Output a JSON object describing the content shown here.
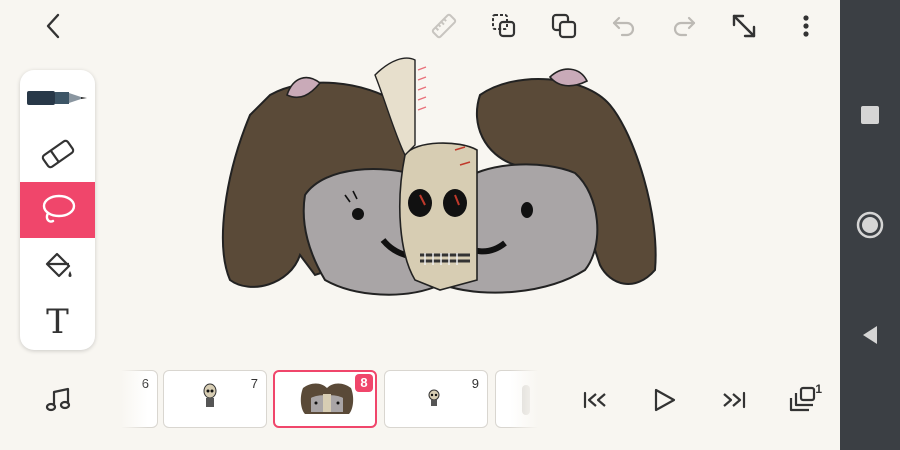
{
  "toolbar": {
    "icons": [
      "back-arrow-icon",
      "ruler-icon",
      "duplicate-frame-icon",
      "copy-layers-icon",
      "undo-icon",
      "redo-icon",
      "expand-icon",
      "more-vert-icon"
    ]
  },
  "tools": {
    "items": [
      "pen",
      "eraser",
      "lasso",
      "fill",
      "text"
    ],
    "active": "lasso",
    "text_tool_label": "T"
  },
  "timeline": {
    "frames": [
      {
        "number": "6"
      },
      {
        "number": "7"
      },
      {
        "number": "8",
        "current": true
      },
      {
        "number": "9"
      }
    ],
    "layers_badge": "1"
  },
  "colors": {
    "accent": "#f0466b",
    "hair": "#5a4a38",
    "face": "#a9a5a6",
    "nav_bar": "#3b3f44"
  }
}
